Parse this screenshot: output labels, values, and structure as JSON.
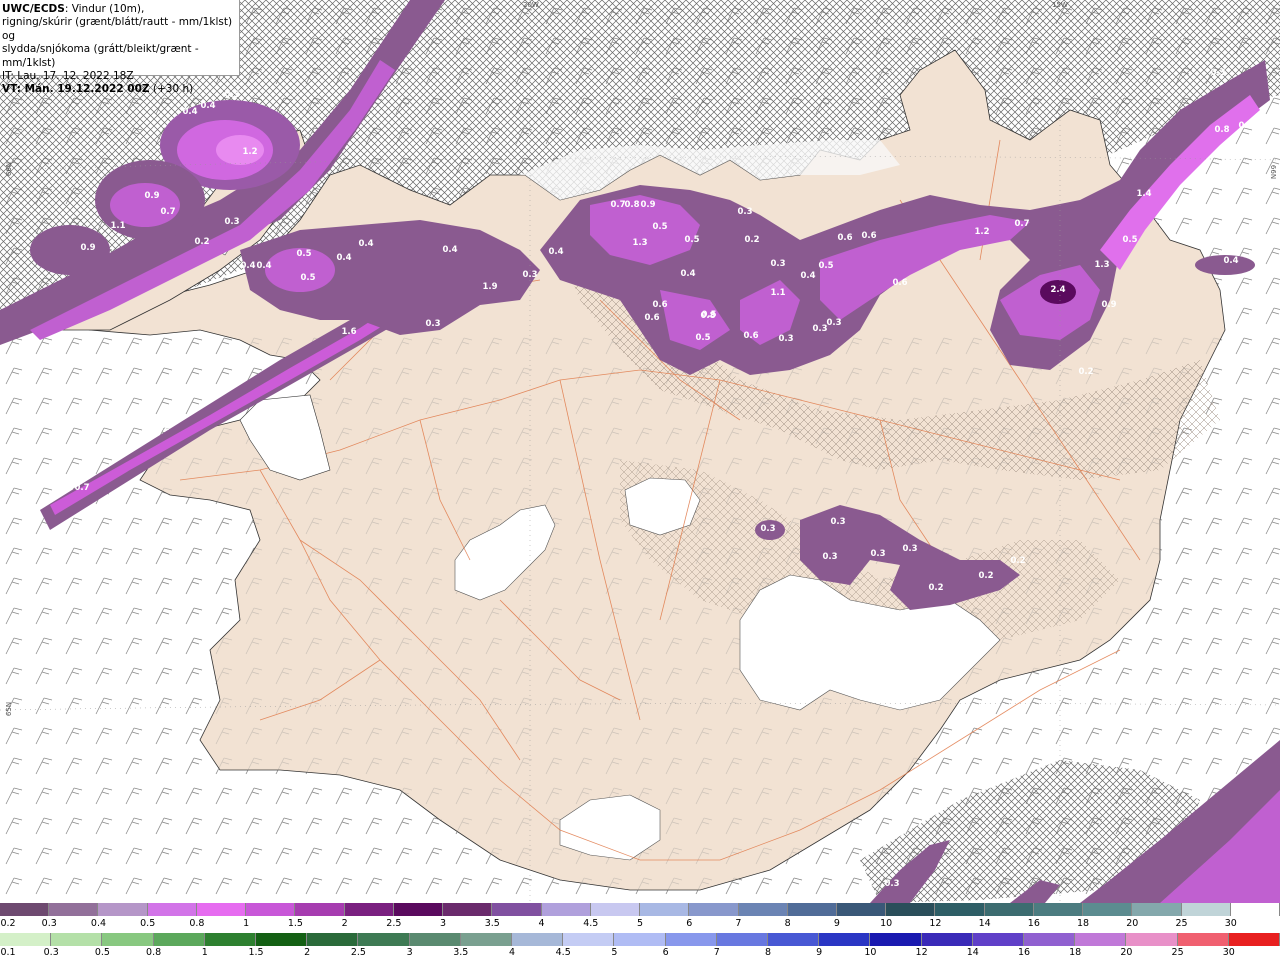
{
  "header": {
    "line1_bold": "UWC/ECDS",
    "line1_rest": ": Vindur (10m),",
    "line2": "rigning/skúrir (grænt/blátt/rautt - mm/1klst) og",
    "line3": "slydda/snjókoma (grátt/bleikt/grænt - mm/1klst)",
    "line4": "IT: Lau. 17. 12. 2022 18Z",
    "line5_bold": "VT: Mán. 19.12.2022 00Z",
    "line5_rest": " (+30 h)"
  },
  "coords": {
    "lon_20w": "20W",
    "lon_15w": "15W",
    "lat_66n": "66N",
    "lat_65n": "65N"
  },
  "map_labels": [
    "0.3",
    "0.4",
    "0.5",
    "0.4",
    "1.2",
    "0.9",
    "0.7",
    "1.1",
    "0.9",
    "0.3",
    "0.2",
    "0.4",
    "0.4",
    "0.5",
    "0.5",
    "0.4",
    "0.4",
    "0.4",
    "0.3",
    "0.3",
    "1.9",
    "1.6",
    "1.2",
    "0.7",
    "0.7",
    "0.8",
    "0.9",
    "1.3",
    "0.5",
    "0.5",
    "0.3",
    "0.4",
    "0.2",
    "0.4",
    "0.3",
    "0.6",
    "0.6",
    "0.5",
    "0.5",
    "0.4",
    "0.6",
    "0.6",
    "0.8",
    "0.5",
    "1.1",
    "0.6",
    "0.3",
    "0.3",
    "0.3",
    "0.5",
    "1.2",
    "0.7",
    "1.3",
    "0.6",
    "2.4",
    "0.9",
    "1.4",
    "0.8",
    "0.7",
    "0.3",
    "0.4",
    "0.2",
    "0.3",
    "0.3",
    "0.3",
    "0.3",
    "0.3",
    "0.2",
    "0.2",
    "0.2",
    "0.3"
  ],
  "legend_snow": {
    "ticks": [
      "0.2",
      "0.3",
      "0.4",
      "0.5",
      "0.8",
      "1",
      "1.5",
      "2",
      "2.5",
      "3",
      "3.5",
      "4",
      "4.5",
      "5",
      "6",
      "7",
      "8",
      "9",
      "10",
      "12",
      "14",
      "16",
      "18",
      "20",
      "25",
      "30"
    ],
    "colors": [
      "#6e4a70",
      "#92709a",
      "#b596c8",
      "#d274e8",
      "#e66cf0",
      "#c857d8",
      "#a63cb0",
      "#7a2080",
      "#5a0a5e",
      "#6a2a6c",
      "#8050a0",
      "#b0a0dc",
      "#c8c8f0",
      "#a8b8e4",
      "#8898cc",
      "#6b84b4",
      "#506c98",
      "#3a5878",
      "#2a4e5a",
      "#2e5e66",
      "#3c6c70",
      "#4c7c80",
      "#5c8c90",
      "#84a8ac",
      "#c0d4d8",
      "#ffffff"
    ]
  },
  "legend_rain": {
    "ticks": [
      "0.1",
      "0.3",
      "0.5",
      "0.8",
      "1",
      "1.5",
      "2",
      "2.5",
      "3",
      "3.5",
      "4",
      "4.5",
      "5",
      "6",
      "7",
      "8",
      "9",
      "10",
      "12",
      "14",
      "16",
      "18",
      "20",
      "25",
      "30"
    ],
    "colors": [
      "#d4f0c8",
      "#b4e0a8",
      "#88c880",
      "#5ca85c",
      "#2e8030",
      "#146014",
      "#2a6a3a",
      "#3e7a54",
      "#5a8a70",
      "#7aa090",
      "#a6b8d8",
      "#c4ccf4",
      "#b0bcf4",
      "#8898ec",
      "#6878e0",
      "#4858d4",
      "#2a36c4",
      "#1a1ab0",
      "#3a2ab8",
      "#6040c8",
      "#9060d0",
      "#c078d8",
      "#e890c8",
      "#f06070",
      "#e82020"
    ]
  }
}
